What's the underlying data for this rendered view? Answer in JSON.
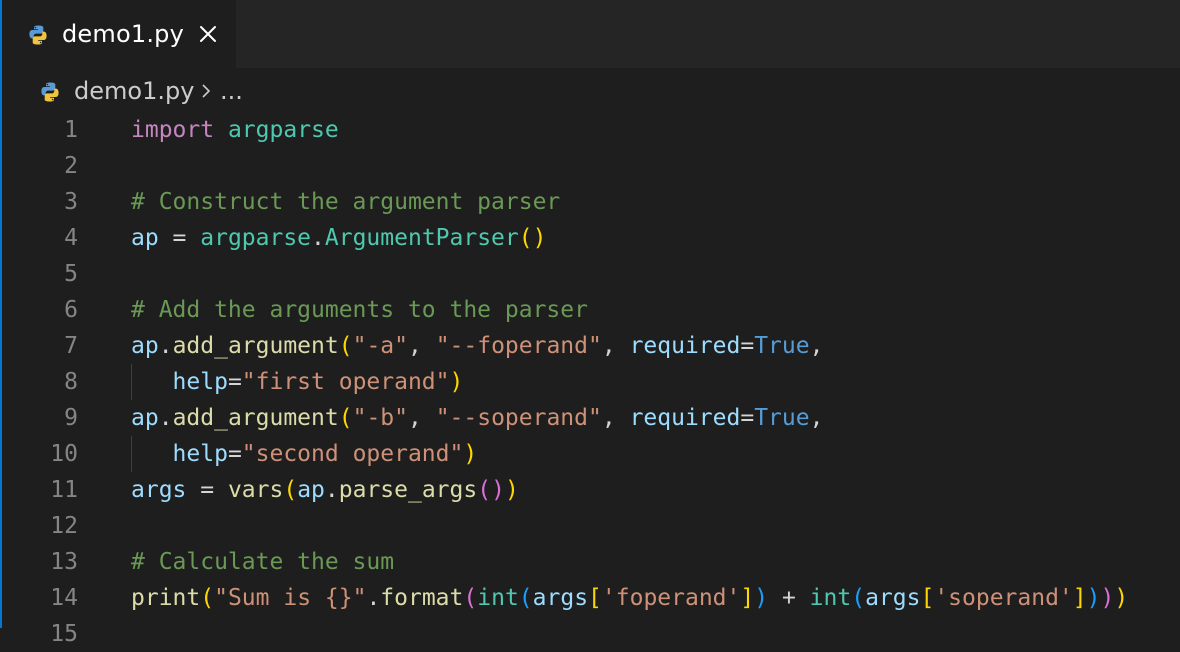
{
  "tab": {
    "label": "demo1.py",
    "icon": "python-icon",
    "close": "close-icon"
  },
  "breadcrumb": {
    "file": "demo1.py",
    "more": "..."
  },
  "lines": [
    {
      "n": "1",
      "tokens": [
        [
          "kw",
          "import"
        ],
        [
          "op",
          " "
        ],
        [
          "mod",
          "argparse"
        ]
      ]
    },
    {
      "n": "2",
      "tokens": []
    },
    {
      "n": "3",
      "tokens": [
        [
          "cmt",
          "# Construct the argument parser"
        ]
      ]
    },
    {
      "n": "4",
      "tokens": [
        [
          "var",
          "ap"
        ],
        [
          "op",
          " = "
        ],
        [
          "mod",
          "argparse"
        ],
        [
          "op",
          "."
        ],
        [
          "mod",
          "ArgumentParser"
        ],
        [
          "b1",
          "()"
        ]
      ]
    },
    {
      "n": "5",
      "tokens": []
    },
    {
      "n": "6",
      "tokens": [
        [
          "cmt",
          "# Add the arguments to the parser"
        ]
      ]
    },
    {
      "n": "7",
      "tokens": [
        [
          "var",
          "ap"
        ],
        [
          "op",
          "."
        ],
        [
          "fn",
          "add_argument"
        ],
        [
          "b1",
          "("
        ],
        [
          "str",
          "\"-a\""
        ],
        [
          "op",
          ", "
        ],
        [
          "str",
          "\"--foperand\""
        ],
        [
          "op",
          ", "
        ],
        [
          "var",
          "required"
        ],
        [
          "op",
          "="
        ],
        [
          "bool",
          "True"
        ],
        [
          "op",
          ","
        ]
      ]
    },
    {
      "n": "8",
      "tokens": [
        [
          "op",
          "   "
        ],
        [
          "var",
          "help"
        ],
        [
          "op",
          "="
        ],
        [
          "str",
          "\"first operand\""
        ],
        [
          "b1",
          ")"
        ]
      ],
      "guide": true
    },
    {
      "n": "9",
      "tokens": [
        [
          "var",
          "ap"
        ],
        [
          "op",
          "."
        ],
        [
          "fn",
          "add_argument"
        ],
        [
          "b1",
          "("
        ],
        [
          "str",
          "\"-b\""
        ],
        [
          "op",
          ", "
        ],
        [
          "str",
          "\"--soperand\""
        ],
        [
          "op",
          ", "
        ],
        [
          "var",
          "required"
        ],
        [
          "op",
          "="
        ],
        [
          "bool",
          "True"
        ],
        [
          "op",
          ","
        ]
      ]
    },
    {
      "n": "10",
      "tokens": [
        [
          "op",
          "   "
        ],
        [
          "var",
          "help"
        ],
        [
          "op",
          "="
        ],
        [
          "str",
          "\"second operand\""
        ],
        [
          "b1",
          ")"
        ]
      ],
      "guide": true
    },
    {
      "n": "11",
      "tokens": [
        [
          "var",
          "args"
        ],
        [
          "op",
          " = "
        ],
        [
          "fn",
          "vars"
        ],
        [
          "b1",
          "("
        ],
        [
          "var",
          "ap"
        ],
        [
          "op",
          "."
        ],
        [
          "fn",
          "parse_args"
        ],
        [
          "b2",
          "()"
        ],
        [
          "b1",
          ")"
        ]
      ]
    },
    {
      "n": "12",
      "tokens": []
    },
    {
      "n": "13",
      "tokens": [
        [
          "cmt",
          "# Calculate the sum"
        ]
      ]
    },
    {
      "n": "14",
      "tokens": [
        [
          "fn",
          "print"
        ],
        [
          "b1",
          "("
        ],
        [
          "str",
          "\"Sum is {}\""
        ],
        [
          "op",
          "."
        ],
        [
          "fn",
          "format"
        ],
        [
          "b2",
          "("
        ],
        [
          "mod",
          "int"
        ],
        [
          "b3",
          "("
        ],
        [
          "var",
          "args"
        ],
        [
          "b1",
          "["
        ],
        [
          "str",
          "'foperand'"
        ],
        [
          "b1",
          "]"
        ],
        [
          "b3",
          ")"
        ],
        [
          "op",
          " + "
        ],
        [
          "mod",
          "int"
        ],
        [
          "b3",
          "("
        ],
        [
          "var",
          "args"
        ],
        [
          "b1",
          "["
        ],
        [
          "str",
          "'soperand'"
        ],
        [
          "b1",
          "]"
        ],
        [
          "b3",
          ")"
        ],
        [
          "b2",
          ")"
        ],
        [
          "b1",
          ")"
        ]
      ]
    },
    {
      "n": "15",
      "tokens": []
    }
  ]
}
